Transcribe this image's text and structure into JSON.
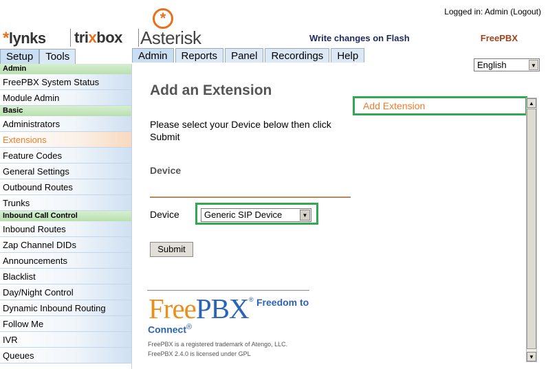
{
  "header": {
    "logged_in_text": "Logged in: Admin",
    "logout_label": "(Logout)",
    "logo_lynks": "lynks",
    "logo_trixbox_a": "tri",
    "logo_trixbox_x": "x",
    "logo_trixbox_b": "box",
    "logo_asterisk": "Asterisk",
    "write_flash": "Write changes on Flash",
    "brand": "FreePBX"
  },
  "left_tabs": [
    {
      "label": "Setup"
    },
    {
      "label": "Tools"
    }
  ],
  "top_tabs": [
    {
      "label": "Admin"
    },
    {
      "label": "Reports"
    },
    {
      "label": "Panel"
    },
    {
      "label": "Recordings"
    },
    {
      "label": "Help"
    }
  ],
  "sidebar": {
    "sections": [
      {
        "title": "Admin",
        "items": [
          "FreePBX System Status",
          "Module Admin"
        ]
      },
      {
        "title": "Basic",
        "items": [
          "Administrators",
          "Extensions",
          "Feature Codes",
          "General Settings",
          "Outbound Routes",
          "Trunks"
        ]
      },
      {
        "title": "Inbound Call Control",
        "items": [
          "Inbound Routes",
          "Zap Channel DIDs",
          "Announcements",
          "Blacklist",
          "Day/Night Control",
          "Dynamic Inbound Routing",
          "Follow Me",
          "IVR",
          "Queues"
        ]
      }
    ],
    "active_item": "Extensions"
  },
  "language": {
    "selected": "English"
  },
  "main": {
    "title": "Add an Extension",
    "instructions": "Please select your Device below then click Submit",
    "device_heading": "Device",
    "device_label": "Device",
    "device_selected": "Generic SIP Device",
    "submit_label": "Submit"
  },
  "footer": {
    "logo_free": "Free",
    "logo_pbx": "PBX",
    "logo_reg": "®",
    "freedom_text": "Freedom to",
    "connect_text": "Connect",
    "connect_reg": "®",
    "trademark": "FreePBX is a registered trademark of Atengo, LLC.",
    "license": "FreePBX 2.4.0 is licensed under GPL"
  },
  "right_pane": {
    "link": "Add Extension"
  },
  "colors": {
    "accent_orange": "#f07c2a",
    "highlight_green": "#32a852",
    "brand_blue": "#2a63b8"
  }
}
